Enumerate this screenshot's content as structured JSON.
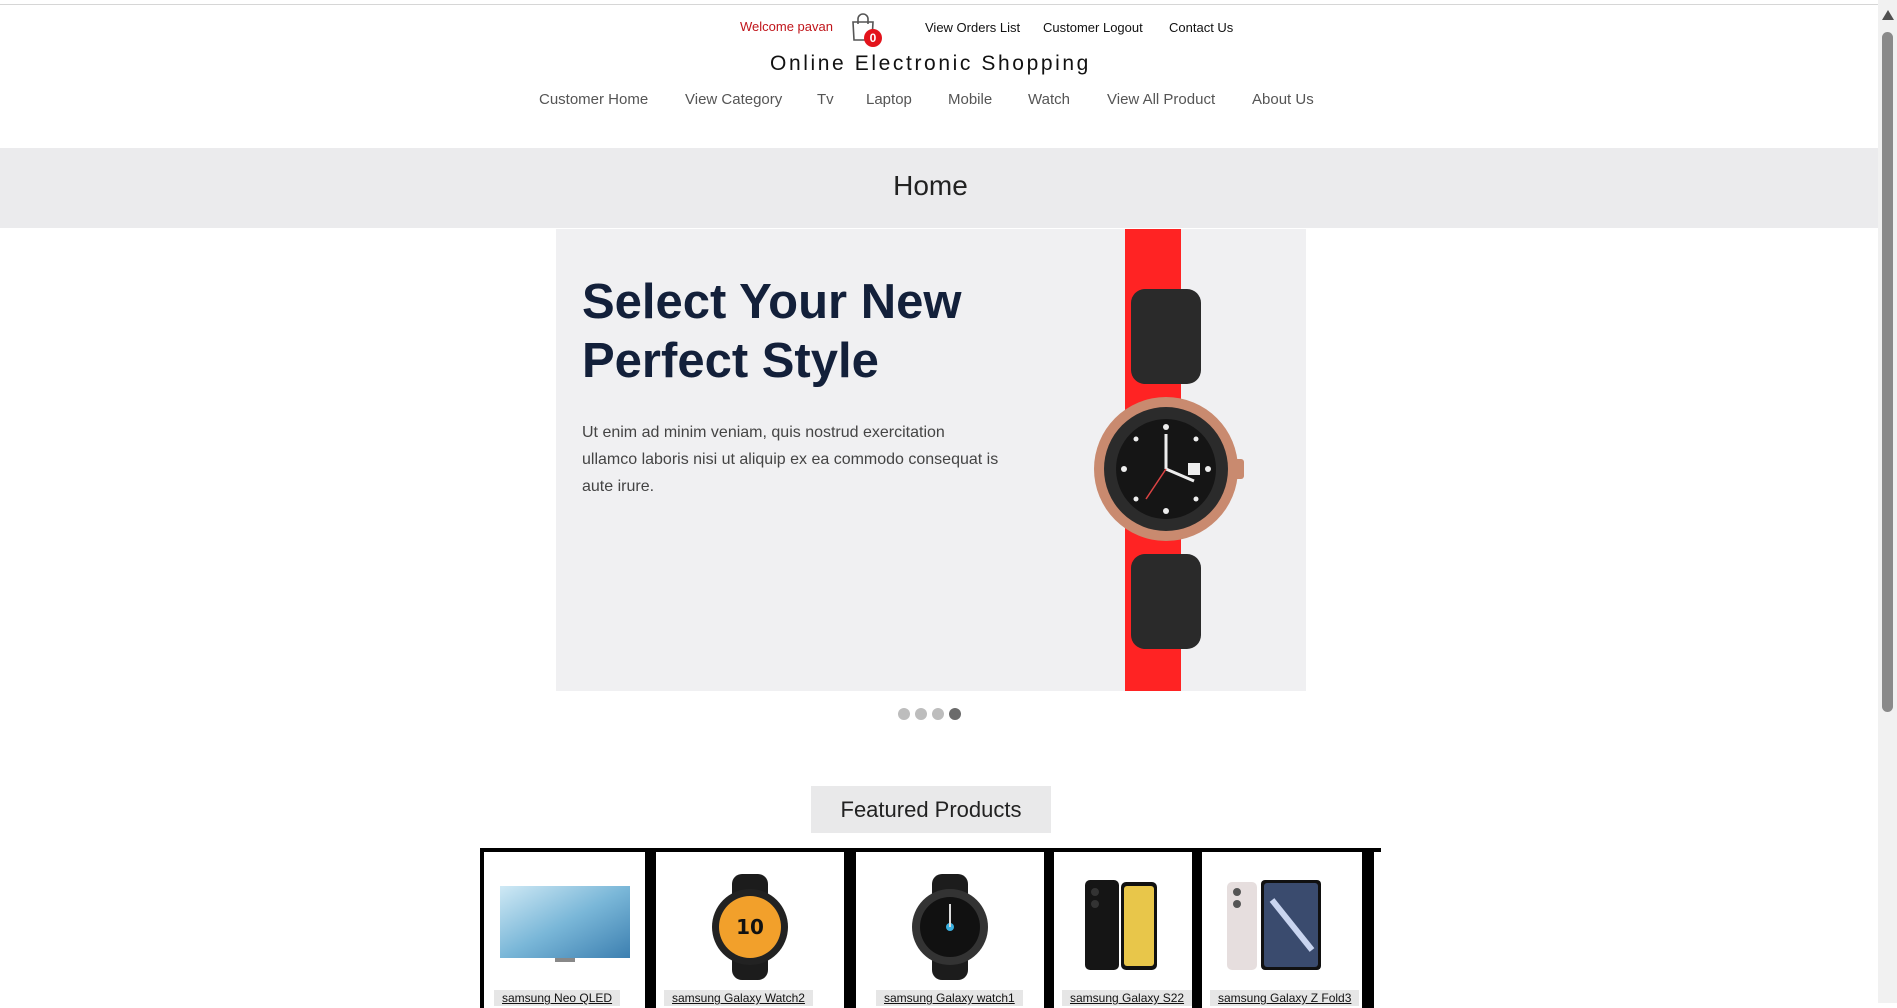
{
  "topbar": {
    "welcome": "Welcome pavan",
    "cart_count": "0",
    "links": [
      "View Orders List",
      "Customer Logout",
      "Contact Us"
    ]
  },
  "brand": "Online Electronic Shopping",
  "nav": [
    "Customer Home",
    "View Category",
    "Tv",
    "Laptop",
    "Mobile",
    "Watch",
    "View All Product",
    "About Us"
  ],
  "page_title": "Home",
  "hero": {
    "title": "Select Your New Perfect Style",
    "text": "Ut enim ad minim veniam, quis nostrud exercitation ullamco laboris nisi ut aliquip ex ea commodo consequat is aute irure.",
    "slides_total": 4,
    "active_slide": 4
  },
  "featured": {
    "title": "Featured Products",
    "products": [
      "samsung Neo QLED",
      "samsung Galaxy Watch2",
      "samsung Galaxy watch1",
      "samsung Galaxy S22",
      "samsung Galaxy Z Fold3"
    ]
  },
  "colors": {
    "accent_red": "#ff2323",
    "welcome_red": "#c0141a",
    "band": "#ebebed"
  }
}
